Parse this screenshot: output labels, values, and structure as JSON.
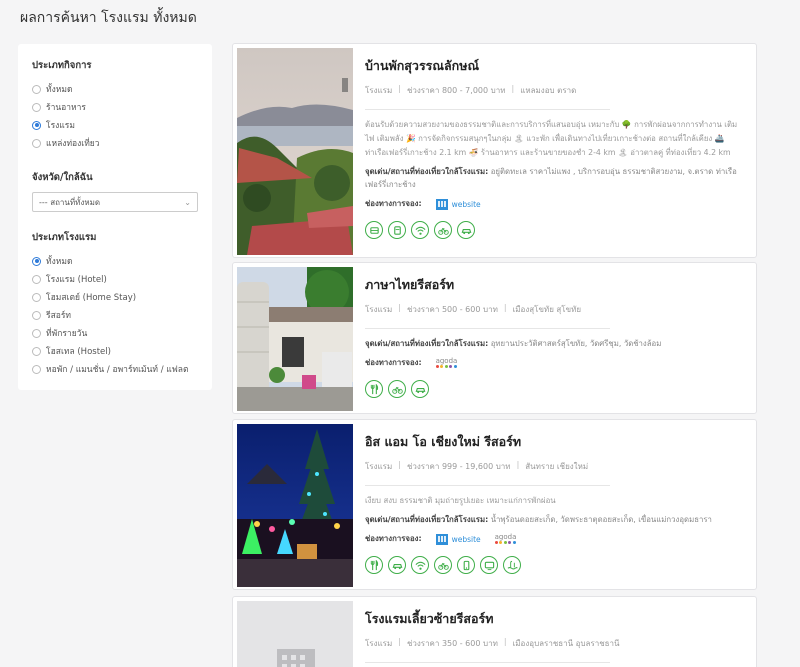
{
  "page_title": "ผลการค้นหา โรงแรม ทั้งหมด",
  "filters": {
    "category_title": "ประเภทกิจการ",
    "categories": [
      {
        "label": "ทั้งหมด",
        "checked": false
      },
      {
        "label": "ร้านอาหาร",
        "checked": false
      },
      {
        "label": "โรงแรม",
        "checked": true
      },
      {
        "label": "แหล่งท่องเที่ยว",
        "checked": false
      }
    ],
    "province_title": "จังหวัด/ใกล้ฉัน",
    "province_value": "--- สถานที่ทั้งหมด",
    "hotel_type_title": "ประเภทโรงแรม",
    "hotel_types": [
      {
        "label": "ทั้งหมด",
        "checked": true
      },
      {
        "label": "โรงแรม (Hotel)",
        "checked": false
      },
      {
        "label": "โฮมสเตย์ (Home Stay)",
        "checked": false
      },
      {
        "label": "รีสอร์ท",
        "checked": false
      },
      {
        "label": "ที่พักรายวัน",
        "checked": false
      },
      {
        "label": "โฮสเทล (Hostel)",
        "checked": false
      },
      {
        "label": "หอพัก / แมนชั่น / อพาร์ทเม้นท์ / แฟลต",
        "checked": false
      }
    ]
  },
  "labels": {
    "nearby": "จุดเด่น/สถานที่ท่องเที่ยวใกล้โรงแรม:",
    "booking": "ช่องทางการจอง:",
    "website": "website",
    "agoda": "agoda"
  },
  "hotels": [
    {
      "name": "บ้านพักสุวรรณลักษณ์",
      "type": "โรงแรม",
      "price": "ช่วงราคา 800 - 7,000 บาท",
      "location": "แหลมงอบ ตราด",
      "description": "ต้อนรับด้วยความสวยงามของธรรมชาติและการบริการที่แสนอบอุ่น เหมาะกับ 🌳 การพักผ่อนจากการทำงาน เติมไฟ เติมพลัง 🎉 การจัดกิจกรรมสนุกๆในกลุ่ม 🏝 แวะพัก เพื่อเดินทางไปเที่ยวเกาะช้างต่อ สถานที่ใกล้เคียง 🚢 ท่าเรือเฟอร์รี่เกาะช้าง 2.1 km 🍜 ร้านอาหาร และร้านขายของชำ 2-4 km 🏝 อ่าวตาลคู่ ที่ท่องเที่ยว 4.2 km",
      "nearby": "อยู่ติดทะเล ราคาไม่แพง , บริการอบอุ่น ธรรมชาติสวยงาม, จ.ตราด ท่าเรือเฟอร์รี่เกาะช้าง",
      "booking": [
        "website"
      ],
      "amenities": [
        "restaurant-icon",
        "breakfast-icon",
        "wifi-icon",
        "bicycle-icon",
        "car-icon"
      ]
    },
    {
      "name": "ภาษาไทยรีสอร์ท",
      "type": "โรงแรม",
      "price": "ช่วงราคา 500 - 600 บาท",
      "location": "เมืองสุโขทัย สุโขทัย",
      "description": "",
      "nearby": "อุทยานประวัติศาสตร์สุโขทัย, วัดศรีชุม, วัดช้างล้อม",
      "booking": [
        "agoda"
      ],
      "amenities": [
        "fork-knife-icon",
        "bicycle-icon",
        "car-icon"
      ]
    },
    {
      "name": "อิส แอม โอ เชียงใหม่ รีสอร์ท",
      "type": "โรงแรม",
      "price": "ช่วงราคา 999 - 19,600 บาท",
      "location": "สันทราย เชียงใหม่",
      "description": "เงียบ สงบ ธรรมชาติ มุมถ่ายรูปเยอะ เหมาะแก่การพักผ่อน",
      "nearby": "น้ำพุร้อนดอยสะเก็ด, วัดพระธาตุดอยสะเก็ด, เขื่อนแม่กวงอุดมธารา",
      "booking": [
        "website",
        "agoda"
      ],
      "amenities": [
        "fork-knife-icon",
        "car-icon",
        "wifi-icon",
        "bicycle-icon",
        "phone-icon",
        "tv-icon",
        "pool-icon"
      ]
    },
    {
      "name": "โรงแรมเลี้ยวซ้ายรีสอร์ท",
      "type": "โรงแรม",
      "price": "ช่วงราคา 350 - 600 บาท",
      "location": "เมืองอุบลราชธานี อุบลราชธานี",
      "description": "",
      "nearby": "",
      "booking": [],
      "amenities": []
    }
  ],
  "colors": {
    "accent": "#3fae49",
    "link": "#2f8fd9",
    "radio": "#2f7bd9"
  }
}
